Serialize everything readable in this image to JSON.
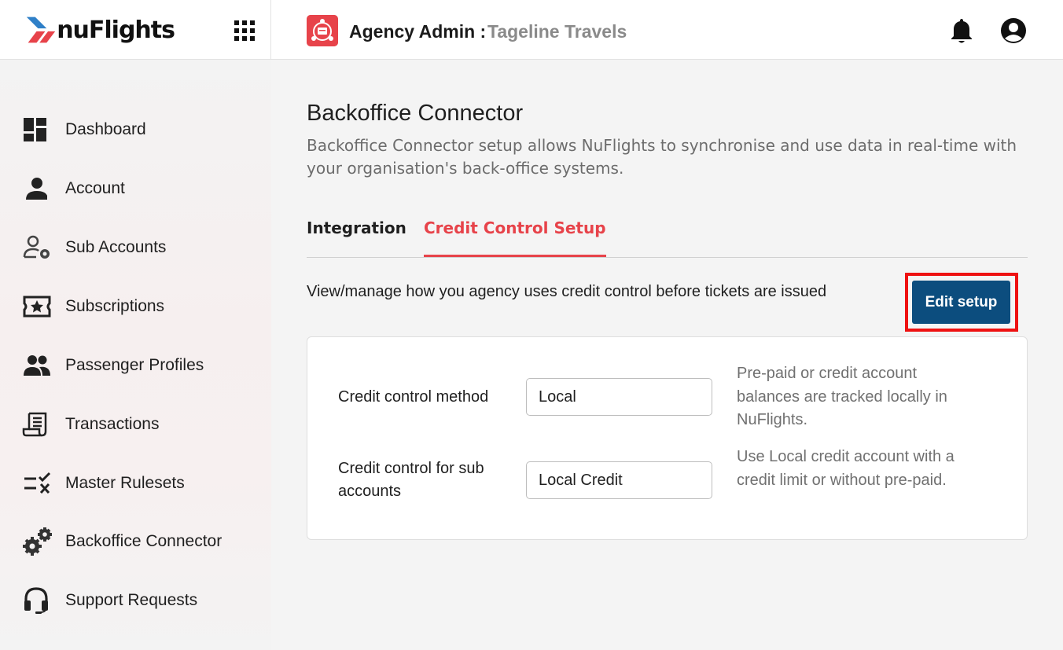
{
  "app": {
    "logo_text": "nuFlights",
    "header_title": "Agency Admin :",
    "header_subtitle": "Tageline Travels",
    "colors": {
      "brand_red": "#e7434a",
      "brand_blue": "#0c4d7e",
      "highlight": "#ee1111"
    },
    "icons": [
      "apps-grid-icon",
      "agency-icon",
      "bell-icon",
      "user-account-icon"
    ]
  },
  "sidebar": {
    "items": [
      {
        "label": "Dashboard",
        "icon": "dashboard-icon"
      },
      {
        "label": "Account",
        "icon": "person-icon"
      },
      {
        "label": "Sub Accounts",
        "icon": "user-gear-icon"
      },
      {
        "label": "Subscriptions",
        "icon": "ticket-star-icon"
      },
      {
        "label": "Passenger Profiles",
        "icon": "people-icon"
      },
      {
        "label": "Transactions",
        "icon": "receipt-icon"
      },
      {
        "label": "Master Rulesets",
        "icon": "ruleset-icon"
      },
      {
        "label": "Backoffice Connector",
        "icon": "gears-icon"
      },
      {
        "label": "Support Requests",
        "icon": "headset-icon"
      }
    ]
  },
  "main": {
    "title": "Backoffice Connector",
    "description": "Backoffice Connector setup allows NuFlights to synchronise and use data in real-time with your organisation's back-office systems.",
    "tabs": [
      {
        "label": "Integration",
        "active": false
      },
      {
        "label": "Credit Control Setup",
        "active": true
      }
    ],
    "section_description": "View/manage how you agency uses credit control before tickets are issued",
    "edit_button_label": "Edit setup",
    "fields": [
      {
        "label": "Credit control method",
        "value": "Local",
        "help": "Pre-paid or credit account balances are tracked locally in NuFlights."
      },
      {
        "label": "Credit control for sub accounts",
        "value": "Local Credit",
        "help": "Use Local credit account with a credit limit or without pre-paid."
      }
    ]
  }
}
